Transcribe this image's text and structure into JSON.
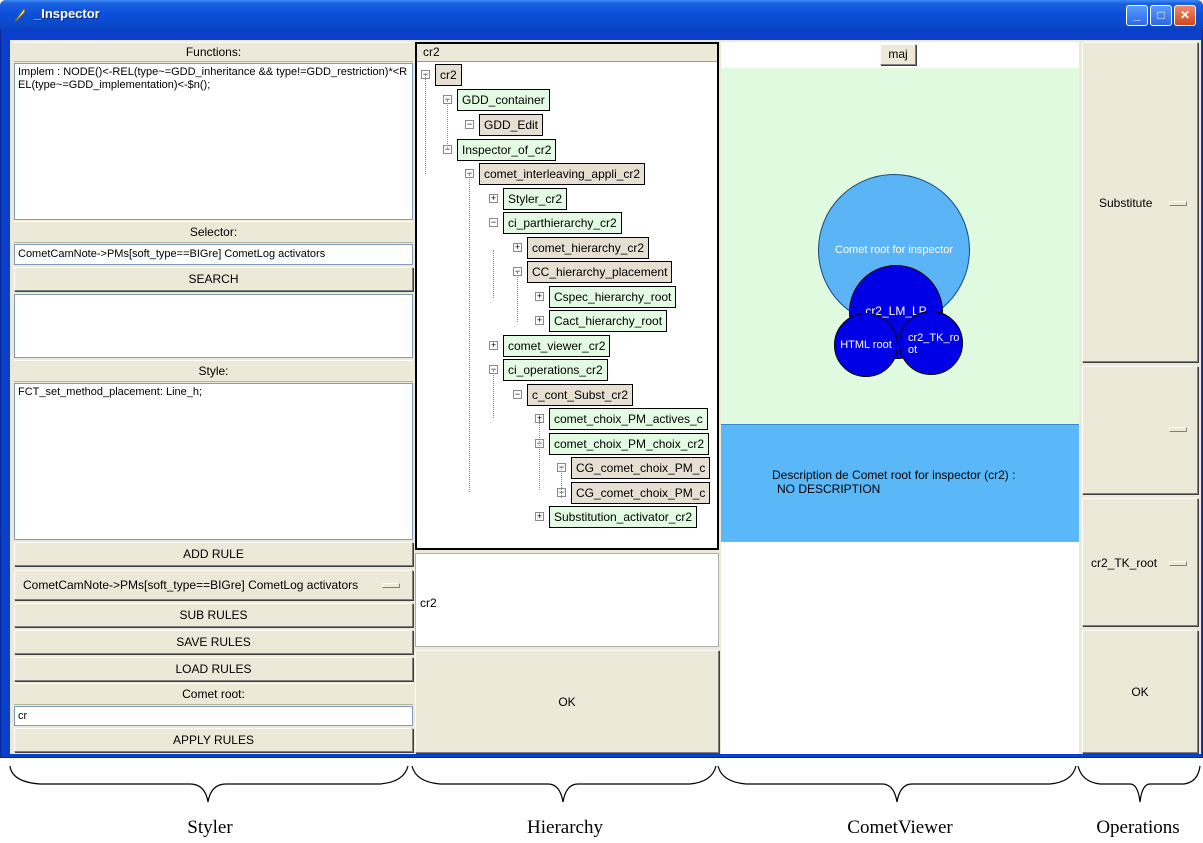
{
  "window": {
    "title": "_Inspector",
    "min": "_",
    "max": "□",
    "close": "✕"
  },
  "styler": {
    "functions_label": "Functions:",
    "functions_text": "Implem : NODE()<-REL(type~=GDD_inheritance && type!=GDD_restriction)*<REL(type~=GDD_implementation)<-$n();",
    "selector_label": "Selector:",
    "selector_value": "CometCamNote->PMs[soft_type==BIGre] CometLog activators",
    "search_btn": "SEARCH",
    "style_label": "Style:",
    "style_text": "FCT_set_method_placement: Line_h;",
    "add_rule_btn": "ADD RULE",
    "rule_select": "CometCamNote->PMs[soft_type==BIGre] CometLog activators",
    "sub_rules_btn": "SUB RULES",
    "save_rules_btn": "SAVE RULES",
    "load_rules_btn": "LOAD RULES",
    "comet_root_label": "Comet root:",
    "comet_root_value": "cr",
    "apply_rules_btn": "APPLY RULES"
  },
  "hierarchy": {
    "header": "cr2",
    "nodes": [
      {
        "label": "cr2"
      },
      {
        "label": "GDD_container"
      },
      {
        "label": "GDD_Edit"
      },
      {
        "label": "Inspector_of_cr2"
      },
      {
        "label": "comet_interleaving_appli_cr2"
      },
      {
        "label": "Styler_cr2"
      },
      {
        "label": "ci_parthierarchy_cr2"
      },
      {
        "label": "comet_hierarchy_cr2"
      },
      {
        "label": "CC_hierarchy_placement"
      },
      {
        "label": "Cspec_hierarchy_root"
      },
      {
        "label": "Cact_hierarchy_root"
      },
      {
        "label": "comet_viewer_cr2"
      },
      {
        "label": "ci_operations_cr2"
      },
      {
        "label": "c_cont_Subst_cr2"
      },
      {
        "label": "comet_choix_PM_actives_c"
      },
      {
        "label": "comet_choix_PM_choix_cr2"
      },
      {
        "label": "CG_comet_choix_PM_c"
      },
      {
        "label": "CG_comet_choix_PM_c"
      },
      {
        "label": "Substitution_activator_cr2"
      }
    ],
    "selected_text": "cr2",
    "ok_btn": "OK"
  },
  "viewer": {
    "maj_btn": "maj",
    "circle_root": "Comet root for inspector",
    "circle_lm": "cr2_LM_LP",
    "circle_html": "HTML root",
    "circle_tk": "cr2_TK_ro ot",
    "description_title": "Description de Comet root for inspector (cr2) :",
    "description_body": "NO DESCRIPTION",
    "colors": {
      "bg_green": "#e0fae0",
      "root_blue": "#5ab4f5",
      "dark_blue": "#0000e6",
      "desc_blue": "#5ab8f8"
    }
  },
  "operations": {
    "substitute": "Substitute",
    "empty": "",
    "tk_root": "cr2_TK_root",
    "ok_btn": "OK"
  },
  "captions": {
    "styler": "Styler",
    "hierarchy": "Hierarchy",
    "viewer": "CometViewer",
    "operations": "Operations"
  }
}
